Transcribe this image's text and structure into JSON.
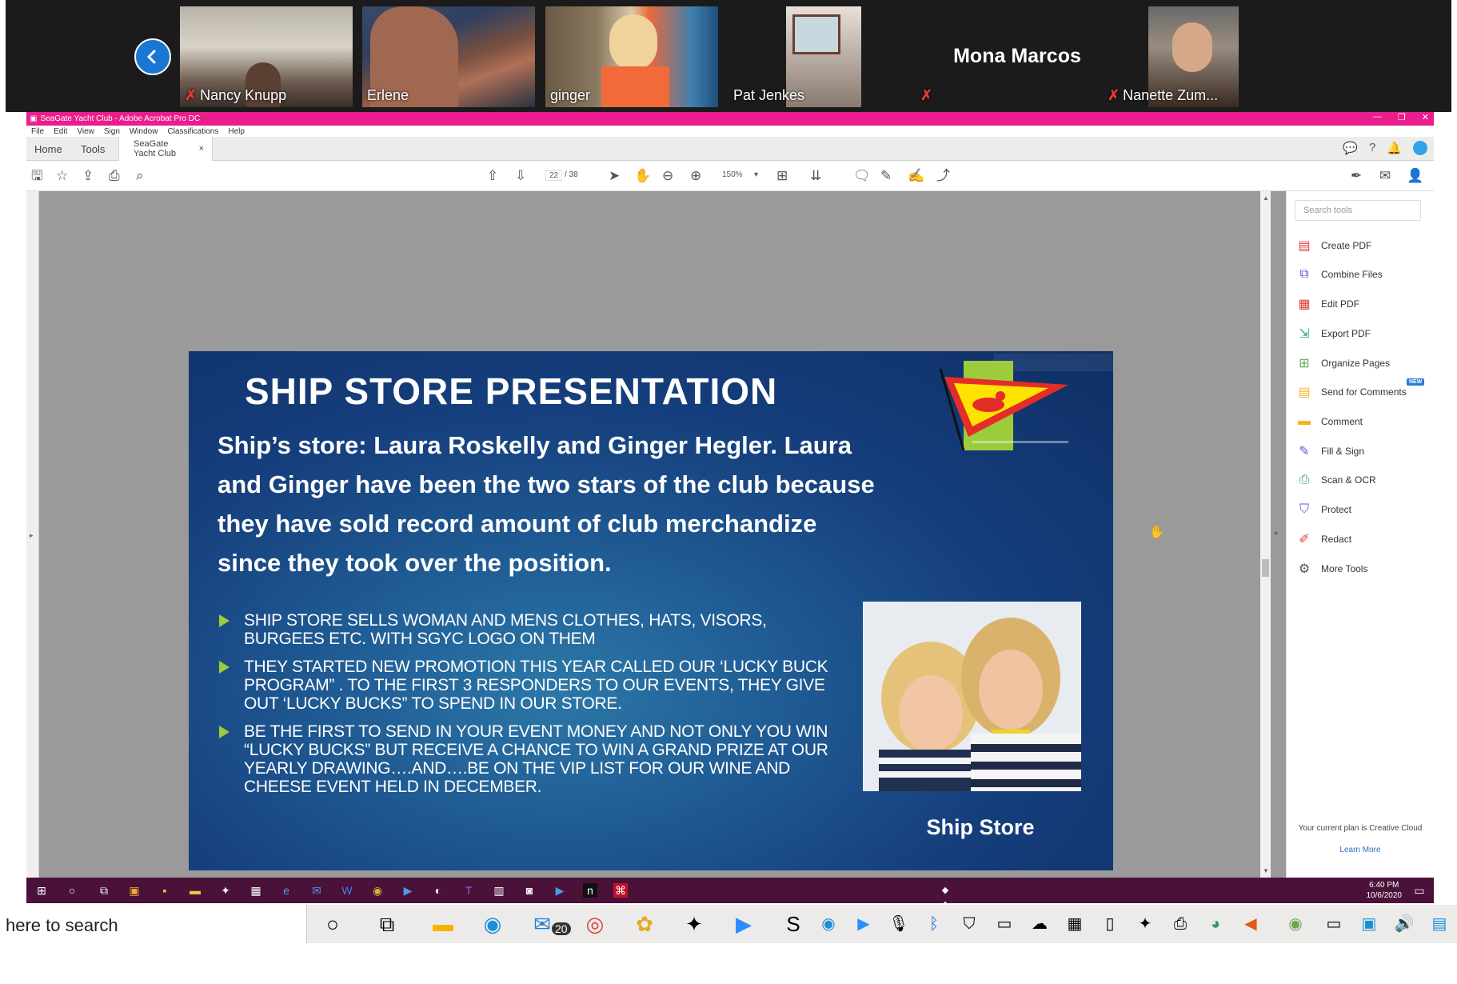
{
  "zoom": {
    "participants": [
      {
        "name": "Nancy Knupp",
        "muted": true
      },
      {
        "name": "Erlene",
        "muted": false
      },
      {
        "name": "ginger",
        "muted": false
      },
      {
        "name": "Pat Jenkes",
        "muted": false
      },
      {
        "name": "Mona Marcos",
        "muted": true
      },
      {
        "name": "Nanette Zum...",
        "muted": true
      }
    ]
  },
  "acrobat": {
    "window_title": "SeaGate Yacht Club - Adobe Acrobat Pro DC",
    "menu": [
      "File",
      "Edit",
      "View",
      "Sign",
      "Window",
      "Classifications",
      "Help"
    ],
    "tabs": {
      "home": "Home",
      "tools": "Tools",
      "doc": "SeaGate Yacht Club",
      "close": "×"
    },
    "toolbar": {
      "page_current": "22",
      "page_total": "/ 38",
      "zoom": "150%"
    }
  },
  "slide": {
    "title": "SHIP STORE PRESENTATION",
    "intro": "Ship’s store: Laura Roskelly and Ginger Hegler. Laura and Ginger have been the two stars of the club because they have sold record amount of club merchandize since they took over the position.",
    "bullets": [
      "Ship store sells woman and mens clothes, hats, visors, burgees etc. with SGYC logo on them",
      "They started new promotion this year called our ‘Lucky Buck Program” . To the first 3 responders to our events, they give out ‘Lucky bucks” to spend in our store.",
      "Be the first to send in your event money and not only you win “lucky bucks” but receive a chance to win a Grand prize at our yearly drawing….and….be on the VIP list for our wine and cheese event held in December."
    ],
    "photo_caption": "Ship Store"
  },
  "tools_pane": {
    "search_placeholder": "Search tools",
    "items": [
      {
        "label": "Create PDF",
        "icon": "create-pdf-icon",
        "color": "#e0393e"
      },
      {
        "label": "Combine Files",
        "icon": "combine-files-icon",
        "color": "#5b5bd6"
      },
      {
        "label": "Edit PDF",
        "icon": "edit-pdf-icon",
        "color": "#e0393e"
      },
      {
        "label": "Export PDF",
        "icon": "export-pdf-icon",
        "color": "#2f9f8f"
      },
      {
        "label": "Organize Pages",
        "icon": "organize-pages-icon",
        "color": "#6aa84f"
      },
      {
        "label": "Send for Comments",
        "icon": "send-comments-icon",
        "color": "#f2b51d"
      },
      {
        "label": "Comment",
        "icon": "comment-icon",
        "color": "#f2b51d"
      },
      {
        "label": "Fill & Sign",
        "icon": "fill-sign-icon",
        "color": "#7b4fd1"
      },
      {
        "label": "Scan & OCR",
        "icon": "scan-ocr-icon",
        "color": "#2e9d5a"
      },
      {
        "label": "Protect",
        "icon": "protect-icon",
        "color": "#5b5bd6"
      },
      {
        "label": "Redact",
        "icon": "redact-icon",
        "color": "#e0393e"
      },
      {
        "label": "More Tools",
        "icon": "more-tools-icon",
        "color": "#555555"
      }
    ],
    "new_badge": "NEW",
    "plan_text": "Your current plan is Creative Cloud",
    "learn_more": "Learn More"
  },
  "inner_taskbar": {
    "time": "6:40 PM",
    "date": "10/6/2020"
  },
  "local_taskbar": {
    "search_text": "here to search",
    "mail_badge": "20"
  }
}
